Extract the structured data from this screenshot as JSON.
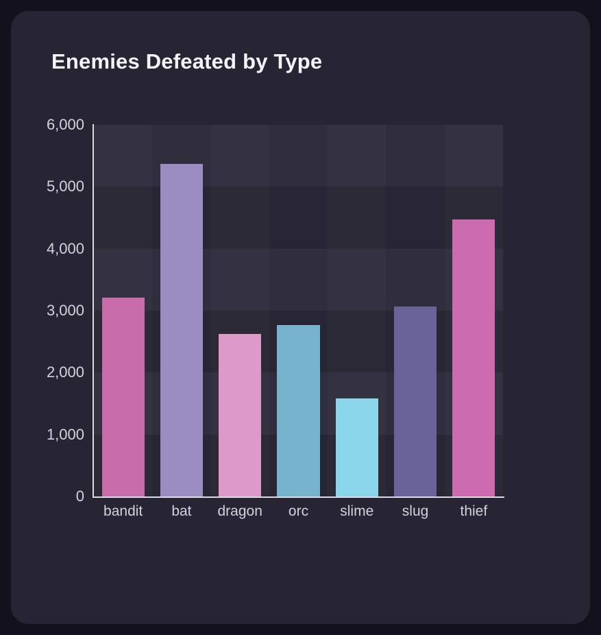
{
  "card": {
    "background_color": "#272433",
    "page_background_color": "#14111e"
  },
  "chart_data": {
    "type": "bar",
    "title": "Enemies Defeated by Type",
    "xlabel": "",
    "ylabel": "",
    "categories": [
      "bandit",
      "bat",
      "dragon",
      "orc",
      "slime",
      "slug",
      "thief"
    ],
    "values": [
      3210,
      5370,
      2620,
      2770,
      1580,
      3070,
      4470
    ],
    "colors": [
      "#c96cac",
      "#9a8bc0",
      "#dd9ac8",
      "#77b3cc",
      "#8cd6ec",
      "#6a6399",
      "#cb6cb0"
    ],
    "ylim": [
      0,
      6000
    ],
    "ytick_values": [
      0,
      1000,
      2000,
      3000,
      4000,
      5000,
      6000
    ],
    "ytick_labels": [
      "0",
      "1,000",
      "2,000",
      "3,000",
      "4,000",
      "5,000",
      "6,000"
    ],
    "grid": false,
    "banded_background": true,
    "legend": "none",
    "axis_color": "#dcdce4",
    "tick_label_color": "#d4d3dd",
    "title_color": "#f4f3f7"
  }
}
